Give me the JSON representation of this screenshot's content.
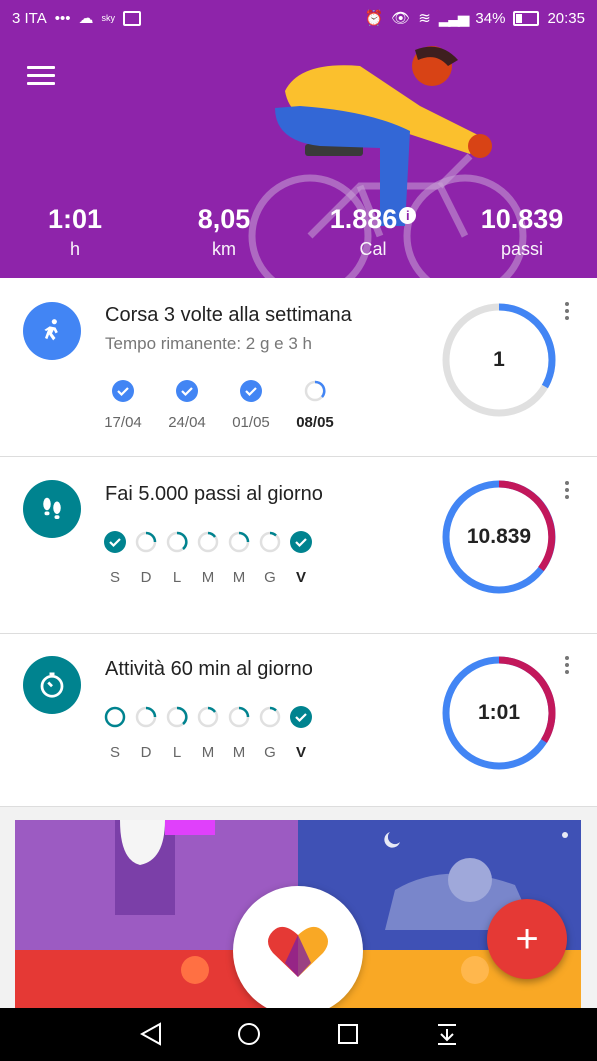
{
  "status_bar": {
    "carrier": "3 ITA",
    "battery": "34%",
    "time": "20:35"
  },
  "stats": [
    {
      "value": "1:01",
      "unit": "h"
    },
    {
      "value": "8,05",
      "unit": "km"
    },
    {
      "value": "1.886",
      "unit": "Cal"
    },
    {
      "value": "10.839",
      "unit": "passi"
    }
  ],
  "goal_run": {
    "title": "Corsa 3 volte alla settimana",
    "subtitle": "Tempo rimanente: 2 g e 3 h",
    "ring_value": "1",
    "ring_progress": 0.33,
    "weeks": [
      "17/04",
      "24/04",
      "01/05",
      "08/05"
    ]
  },
  "goal_steps": {
    "title": "Fai 5.000 passi al giorno",
    "ring_value": "10.839",
    "days": [
      "S",
      "D",
      "L",
      "M",
      "M",
      "G",
      "V"
    ]
  },
  "goal_active": {
    "title": "Attività 60 min al giorno",
    "ring_value": "1:01",
    "days": [
      "S",
      "D",
      "L",
      "M",
      "M",
      "G",
      "V"
    ]
  },
  "fab": {
    "label": "+"
  },
  "colors": {
    "header": "#8e24aa",
    "blue": "#4285f4",
    "teal": "#00838f",
    "magenta": "#c2185b",
    "fab": "#e53935"
  }
}
